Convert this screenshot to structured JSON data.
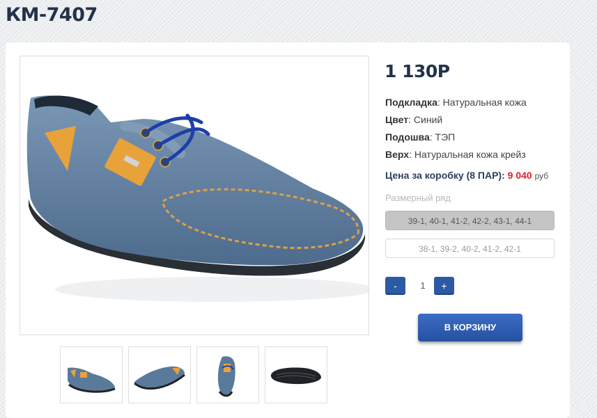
{
  "product": {
    "title": "КМ-7407",
    "price": "1 130Р"
  },
  "specs": [
    {
      "key": "Подкладка",
      "value": "Натуральная кожа"
    },
    {
      "key": "Цвет",
      "value": "Синий"
    },
    {
      "key": "Подошва",
      "value": "ТЭП"
    },
    {
      "key": "Верх",
      "value": "Натуральная кожа крейз"
    }
  ],
  "box_price": {
    "label": "Цена за коробку (8 ПАР)",
    "value": "9 040",
    "unit": "руб"
  },
  "sizes": {
    "title": "Размерный ряд",
    "options": [
      "39-1, 40-1, 41-2, 42-2, 43-1, 44-1",
      "38-1, 39-2, 40-2, 41-2, 42-1"
    ],
    "selected": "39-1, 40-1, 41-2, 42-2, 43-1, 44-1"
  },
  "quantity": {
    "minus_label": "-",
    "value": "1",
    "plus_label": "+"
  },
  "cart": {
    "button_label": "В КОРЗИНУ"
  },
  "gallery": {
    "thumbnails": [
      "shoe-side-view",
      "shoe-angled-view",
      "shoe-front-view",
      "shoe-sole-view"
    ]
  },
  "colors": {
    "title": "#23324b",
    "accent_blue": "#2c5aa4",
    "price_red": "#d8232a",
    "shoe_blue": "#5a7a9b",
    "trim_yellow": "#e8a23a"
  }
}
